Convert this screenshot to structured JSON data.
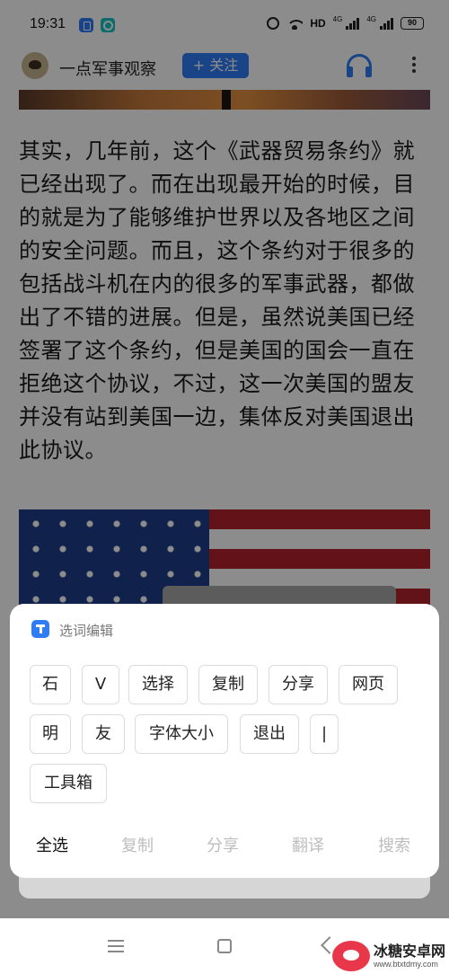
{
  "status_bar": {
    "time": "19:31",
    "network_label": "HD",
    "signal_label_1": "4G",
    "signal_label_2": "4G",
    "battery": "90",
    "icons": [
      "app-notification-icon",
      "app-notification-icon-2",
      "alarm-icon",
      "wifi-icon",
      "signal-icon",
      "battery-icon"
    ]
  },
  "header": {
    "channel_name": "一点军事观察",
    "follow_label": "+ 关注",
    "icons": [
      "avatar",
      "headphones-icon",
      "more-icon"
    ],
    "accent_color": "#2e7cf6"
  },
  "article": {
    "paragraph": "其实，几年前，这个《武器贸易条约》就已经出现了。而在出现最开始的时候，目的就是为了能够维护世界以及各地区之间的安全问题。而且，这个条约对于很多的包括战斗机在内的很多的军事武器，都做出了不错的进展。但是，虽然说美国已经签署了这个条约，但是美国的国会一直在拒绝这个协议，不过，这一次美国的盟友并没有站到美国一边，集体反对美国退出此协议。"
  },
  "sheet": {
    "title": "选词编辑",
    "chips": [
      "石",
      "V",
      "选择",
      "复制",
      "分享",
      "网页",
      "明",
      "友",
      "字体大小",
      "退出",
      "|",
      "工具箱"
    ],
    "actions": [
      "全选",
      "复制",
      "分享",
      "翻译",
      "搜索"
    ]
  },
  "watermark": {
    "main": "冰糖安卓网",
    "sub": "www.btxtdmy.com"
  }
}
